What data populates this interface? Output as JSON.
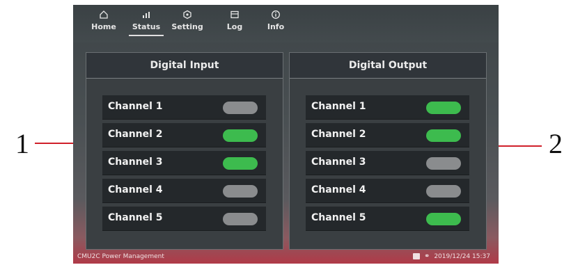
{
  "callouts": {
    "left": "1",
    "right": "2"
  },
  "nav": {
    "items": [
      {
        "label": "Home",
        "icon": "home-icon"
      },
      {
        "label": "Status",
        "icon": "status-icon",
        "active": true
      },
      {
        "label": "Setting",
        "icon": "gear-icon"
      },
      {
        "label": "Log",
        "icon": "log-icon"
      },
      {
        "label": "Info",
        "icon": "info-icon"
      }
    ]
  },
  "digital_input": {
    "title": "Digital Input",
    "channels": [
      {
        "label": "Channel 1",
        "state": "off"
      },
      {
        "label": "Channel 2",
        "state": "on"
      },
      {
        "label": "Channel 3",
        "state": "on"
      },
      {
        "label": "Channel 4",
        "state": "off"
      },
      {
        "label": "Channel 5",
        "state": "off"
      }
    ]
  },
  "digital_output": {
    "title": "Digital Output",
    "channels": [
      {
        "label": "Channel 1",
        "state": "on"
      },
      {
        "label": "Channel 2",
        "state": "on"
      },
      {
        "label": "Channel 3",
        "state": "off"
      },
      {
        "label": "Channel 4",
        "state": "off"
      },
      {
        "label": "Channel 5",
        "state": "on"
      }
    ]
  },
  "status_bar": {
    "app_name": "CMU2C Power Management",
    "datetime": "2019/12/24 15:37"
  },
  "colors": {
    "on": "#3dbb4e",
    "off": "#8a8c8e",
    "callout_line": "#d0202a"
  }
}
